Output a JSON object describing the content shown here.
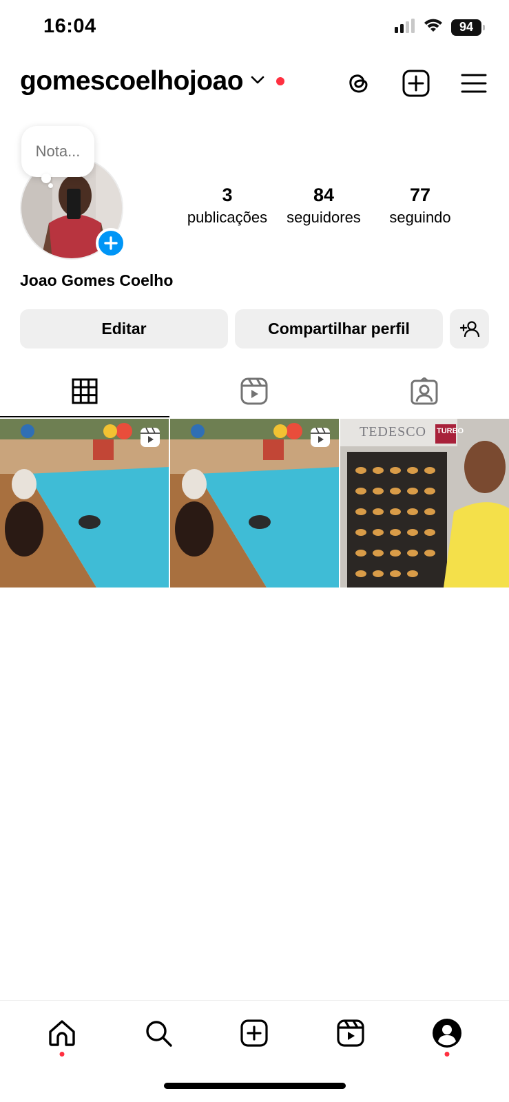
{
  "status_bar": {
    "time": "16:04",
    "battery": "94",
    "icons": [
      "cellular-signal-icon",
      "wifi-icon",
      "battery-icon"
    ]
  },
  "header": {
    "username": "gomescoelhojoao",
    "icons": [
      "chevron-down-icon",
      "notification-dot",
      "threads-icon",
      "new-post-icon",
      "menu-icon"
    ]
  },
  "profile": {
    "note_placeholder": "Nota...",
    "full_name": "Joao Gomes Coelho",
    "stats": [
      {
        "value": "3",
        "label": "publicações"
      },
      {
        "value": "84",
        "label": "seguidores"
      },
      {
        "value": "77",
        "label": "seguindo"
      }
    ]
  },
  "actions": {
    "edit_label": "Editar",
    "share_label": "Compartilhar perfil"
  },
  "tabs": [
    "grid-icon",
    "reels-icon",
    "tagged-icon"
  ],
  "posts": [
    {
      "type": "reel",
      "overlay_text": "",
      "scene": "pool"
    },
    {
      "type": "reel",
      "overlay_text": "",
      "scene": "pool"
    },
    {
      "type": "photo",
      "overlay_text": "TEDESCO",
      "badge_text": "TURBO",
      "scene": "bakery"
    }
  ],
  "bottom_nav": [
    "home-icon",
    "search-icon",
    "create-icon",
    "reels-icon",
    "profile-icon"
  ],
  "colors": {
    "accent_blue": "#0095f6",
    "notification_red": "#ff3040",
    "button_bg": "#efefef"
  }
}
